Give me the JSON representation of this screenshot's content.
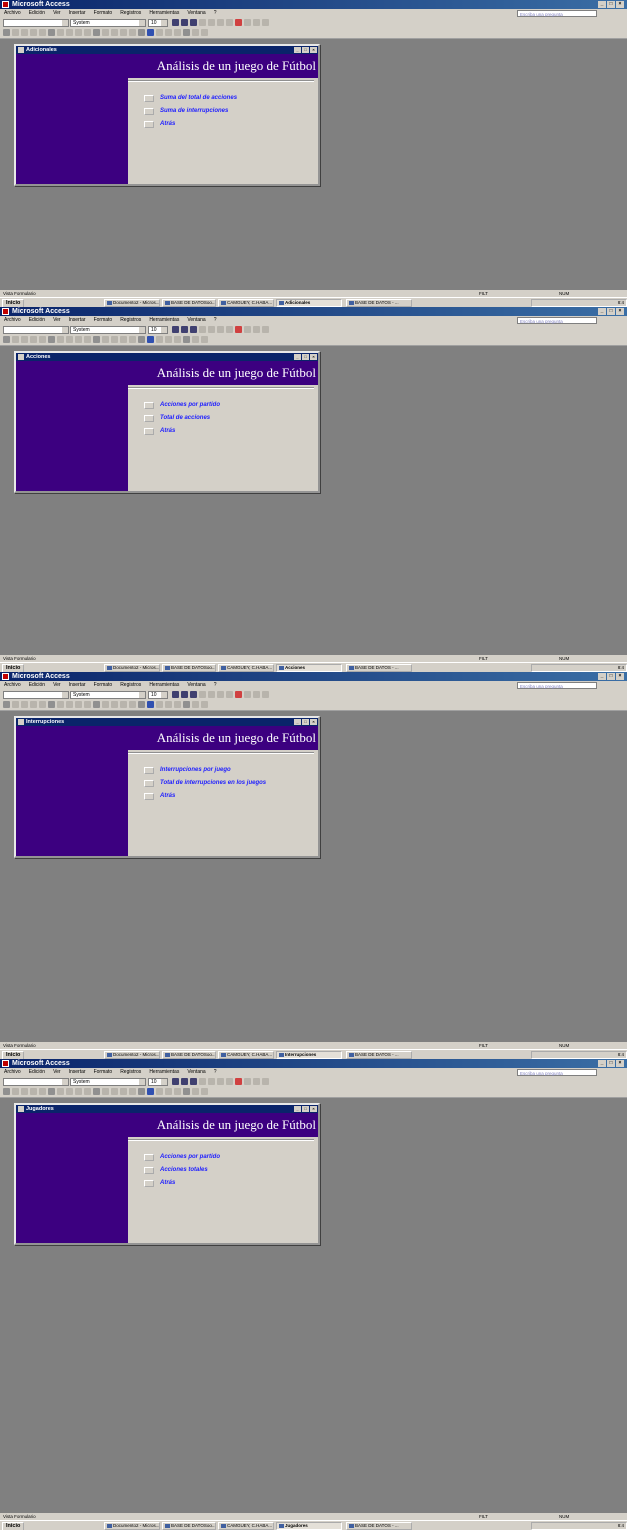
{
  "app": {
    "title": "Microsoft Access",
    "menu": [
      "Archivo",
      "Edición",
      "Ver",
      "Insertar",
      "Formato",
      "Registros",
      "Herramientas",
      "Ventana",
      "?"
    ],
    "ask_placeholder": "Escriba una pregunta",
    "font_name": "System",
    "font_size": "10"
  },
  "status": {
    "left": "Vista Formulario",
    "mid": "FILT",
    "right": "NUM"
  },
  "taskbar": {
    "start": "Inicio",
    "tasks": [
      "Documento2 - Micros...",
      "BASE DE DATOSoo...",
      "CAMGUEY, C.HABA...",
      "",
      "BASE DE DATOS - ..."
    ],
    "clock": "8:4"
  },
  "screens": [
    {
      "form_title": "Adicionales",
      "heading": "Análisis de un juego de Fútbol",
      "items": [
        "Suma del total de acciones",
        "Suma de interrupciones",
        "Atrás"
      ]
    },
    {
      "form_title": "Acciones",
      "heading": "Análisis de un juego de Fútbol",
      "items": [
        "Acciones por partido",
        "Total de acciones",
        "Atrás"
      ]
    },
    {
      "form_title": "Interrupciones",
      "heading": "Análisis de un juego de Fútbol",
      "items": [
        "Interrupciones por juego",
        "Total de interrupciones en los juegos",
        "Atrás"
      ]
    },
    {
      "form_title": "Jugadores",
      "heading": "Análisis de un juego de Fútbol",
      "items": [
        "Acciones por partido",
        "Acciones totales",
        "Atrás"
      ]
    }
  ]
}
